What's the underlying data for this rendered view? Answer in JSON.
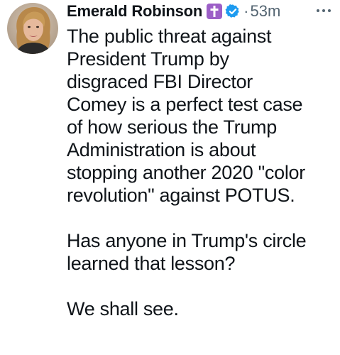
{
  "tweet": {
    "author": {
      "name": "Emerald Robinson",
      "avatar_icon": "profile-photo"
    },
    "badges": {
      "cross_icon": "latin-cross-icon",
      "cross_color": "#9c5fc7",
      "verified_icon": "verified-badge-icon",
      "verified_color": "#1d9bf0"
    },
    "separator": "·",
    "timestamp": "53m",
    "more_icon": "more-options-icon",
    "paragraphs": [
      "The public threat against\nPresident Trump by\ndisgraced FBI Director\nComey is a perfect test case\nof how serious the Trump\nAdministration is about\nstopping another 2020 \"color\nrevolution\" against POTUS.",
      "Has anyone in Trump's circle\nlearned that lesson?",
      "We shall see."
    ]
  }
}
